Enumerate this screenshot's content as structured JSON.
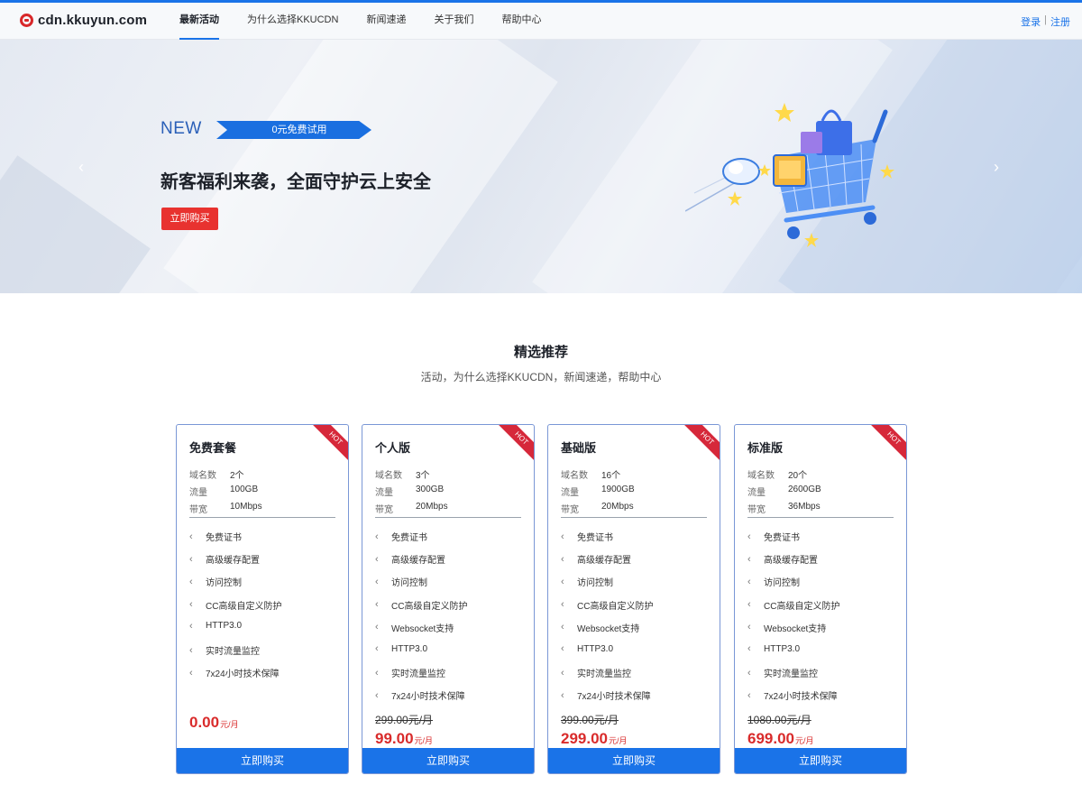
{
  "header": {
    "logo_text": "cdn.kkuyun.com",
    "nav": [
      "最新活动",
      "为什么选择KKUCDN",
      "新闻速递",
      "关于我们",
      "帮助中心"
    ],
    "login": "登录",
    "separator": "|",
    "register": "注册"
  },
  "banner": {
    "new_label": "NEW",
    "ribbon_text": "0元免费试用",
    "title": "新客福利来袭，全面守护云上安全",
    "button": "立即购买",
    "prev_arrow": "‹",
    "next_arrow": "›"
  },
  "section": {
    "title": "精选推荐",
    "subtitle": "活动，为什么选择KKUCDN，新闻速递，帮助中心"
  },
  "spec_labels": [
    "域名数",
    "流量",
    "带宽"
  ],
  "hot_label": "HOT",
  "buy_label": "立即购买",
  "plans": [
    {
      "name": "免费套餐",
      "specs": [
        "2个",
        "100GB",
        "10Mbps"
      ],
      "features": [
        "免费证书",
        "高级缓存配置",
        "访问控制",
        "CC高级自定义防护",
        "HTTP3.0",
        "实时流量监控",
        "7x24小时技术保障"
      ],
      "old_price": "",
      "price": "0.00",
      "unit": "元/月"
    },
    {
      "name": "个人版",
      "specs": [
        "3个",
        "300GB",
        "20Mbps"
      ],
      "features": [
        "免费证书",
        "高级缓存配置",
        "访问控制",
        "CC高级自定义防护",
        "Websocket支持",
        "HTTP3.0",
        "实时流量监控",
        "7x24小时技术保障"
      ],
      "old_price": "299.00元/月",
      "price": "99.00",
      "unit": "元/月"
    },
    {
      "name": "基础版",
      "specs": [
        "16个",
        "1900GB",
        "20Mbps"
      ],
      "features": [
        "免费证书",
        "高级缓存配置",
        "访问控制",
        "CC高级自定义防护",
        "Websocket支持",
        "HTTP3.0",
        "实时流量监控",
        "7x24小时技术保障"
      ],
      "old_price": "399.00元/月",
      "price": "299.00",
      "unit": "元/月"
    },
    {
      "name": "标准版",
      "specs": [
        "20个",
        "2600GB",
        "36Mbps"
      ],
      "features": [
        "免费证书",
        "高级缓存配置",
        "访问控制",
        "CC高级自定义防护",
        "Websocket支持",
        "HTTP3.0",
        "实时流量监控",
        "7x24小时技术保障"
      ],
      "old_price": "1080.00元/月",
      "price": "699.00",
      "unit": "元/月"
    }
  ],
  "colors": {
    "accent": "#1a73e8",
    "price": "#d92b2b",
    "hot": "#d6283a",
    "banner_button": "#e8322f"
  }
}
